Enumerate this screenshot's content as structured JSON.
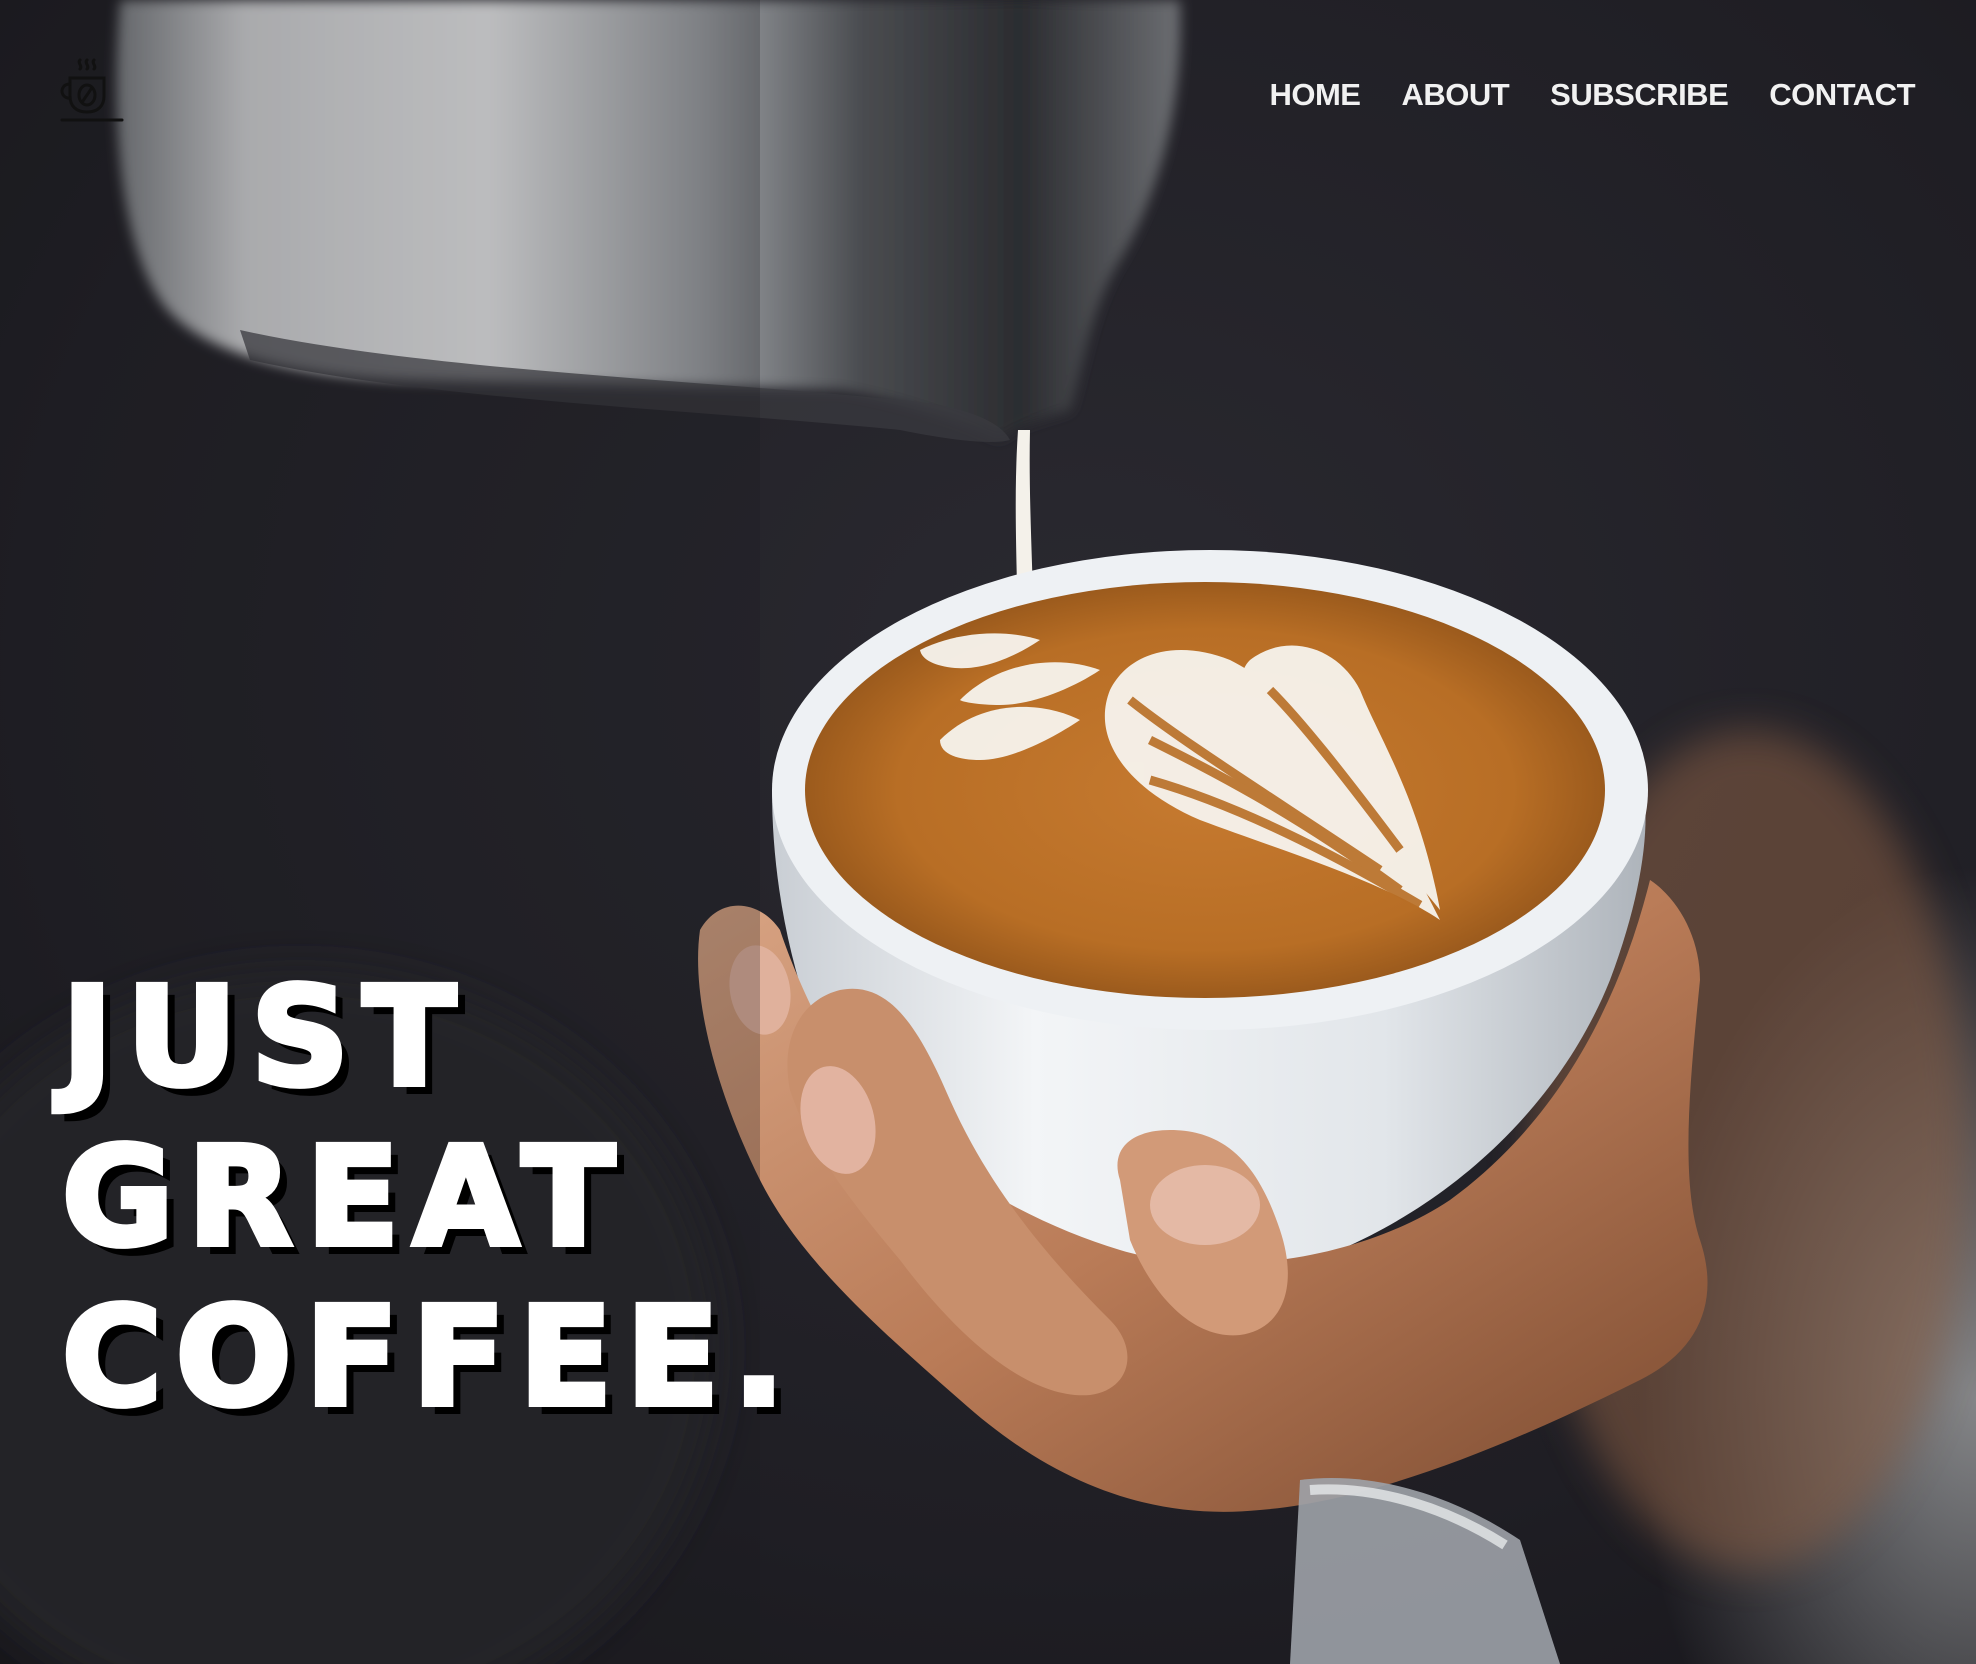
{
  "brand": {
    "logo_icon": "coffee-cup-icon"
  },
  "nav": {
    "items": [
      {
        "label": "HOME"
      },
      {
        "label": "ABOUT"
      },
      {
        "label": "SUBSCRIBE"
      },
      {
        "label": "CONTACT"
      }
    ]
  },
  "hero": {
    "headline_lines": [
      "JUST",
      "GREAT",
      "COFFEE."
    ],
    "image_subject": "latte-art-pour-photo"
  },
  "colors": {
    "background": "#1e1d22",
    "text": "#ffffff",
    "headline_shadow": "#000000",
    "crema": "#b86e25",
    "cup": "#e8ebee"
  }
}
